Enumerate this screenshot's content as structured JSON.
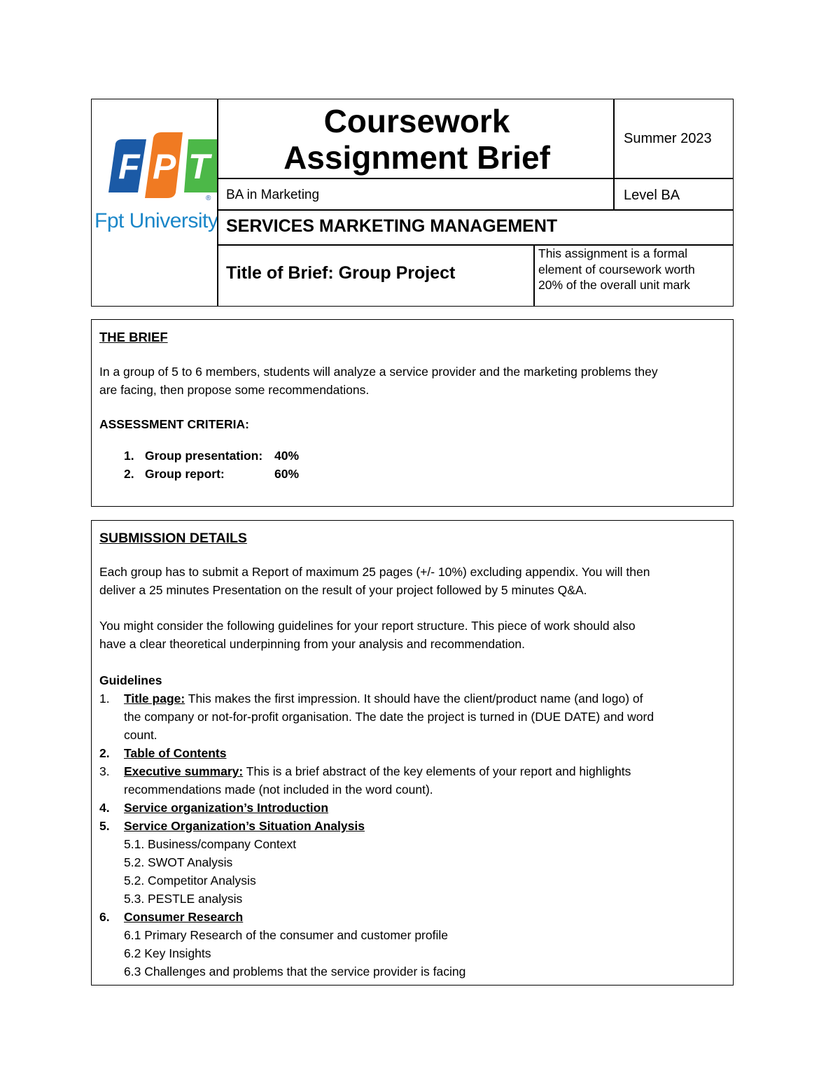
{
  "header": {
    "logo": {
      "letters": [
        "F",
        "P",
        "T"
      ],
      "colors": [
        "#1b5aa6",
        "#f07a22",
        "#4cb848"
      ],
      "registered_mark": "®",
      "university_text": "Fpt University",
      "university_color": "#1a86c8"
    },
    "title_line1": "Coursework",
    "title_line2": "Assignment Brief",
    "season": "Summer 2023",
    "program": "BA in Marketing",
    "level": "Level BA",
    "unit_name": "SERVICES MARKETING MANAGEMENT",
    "brief_title": "Title of Brief: Group Project",
    "weight_note": {
      "line1": "This assignment is a formal",
      "line2": "element of coursework worth",
      "line3": "20% of the overall unit mark"
    }
  },
  "brief": {
    "heading": "THE BRIEF",
    "line1": "In a group of 5 to 6 members, students will analyze a service provider and the marketing problems they",
    "line2": "are facing, then propose some recommendations.",
    "criteria_heading": "ASSESSMENT CRITERIA:",
    "criteria": [
      {
        "num": "1.",
        "label": "Group presentation:",
        "value": "40%"
      },
      {
        "num": "2.",
        "label": "Group report:",
        "value": "60%"
      }
    ]
  },
  "submission": {
    "heading": "SUBMISSION DETAILS",
    "p1_line1": "Each group has to submit a Report of maximum 25 pages (+/- 10%) excluding appendix. You will then",
    "p1_line2": "deliver a 25 minutes Presentation on the result of your project followed by 5 minutes Q&A.",
    "p2_line1": "You might consider the following guidelines for your report structure.  This piece of work should also",
    "p2_line2": "have a clear theoretical underpinning from your analysis and recommendation.",
    "guidelines_heading": "Guidelines",
    "guidelines": [
      {
        "num": "1.",
        "title": "Title page:",
        "lines": [
          "This makes the first impression.  It should have the client/product name (and logo) of",
          "the company or not-for-profit organisation.  The date the project is turned in (DUE DATE) and word",
          "count."
        ]
      },
      {
        "num": "2.",
        "title": "Table of Contents"
      },
      {
        "num": "3.",
        "title": "Executive summary:",
        "lines": [
          "This is a brief abstract of the key elements of your report and highlights",
          "recommendations made (not included in the word count)."
        ]
      },
      {
        "num": "4.",
        "title": "Service organization’s Introduction"
      },
      {
        "num": "5.",
        "title": "Service Organization’s Situation Analysis",
        "subitems": [
          "5.1. Business/company Context",
          "5.2. SWOT Analysis",
          "5.2. Competitor Analysis",
          "5.3. PESTLE analysis"
        ]
      },
      {
        "num": "6.",
        "title": "Consumer Research",
        "subitems": [
          "6.1 Primary Research of the consumer and customer profile",
          "6.2 Key Insights",
          "6.3 Challenges and problems that the service provider is facing"
        ]
      }
    ]
  }
}
